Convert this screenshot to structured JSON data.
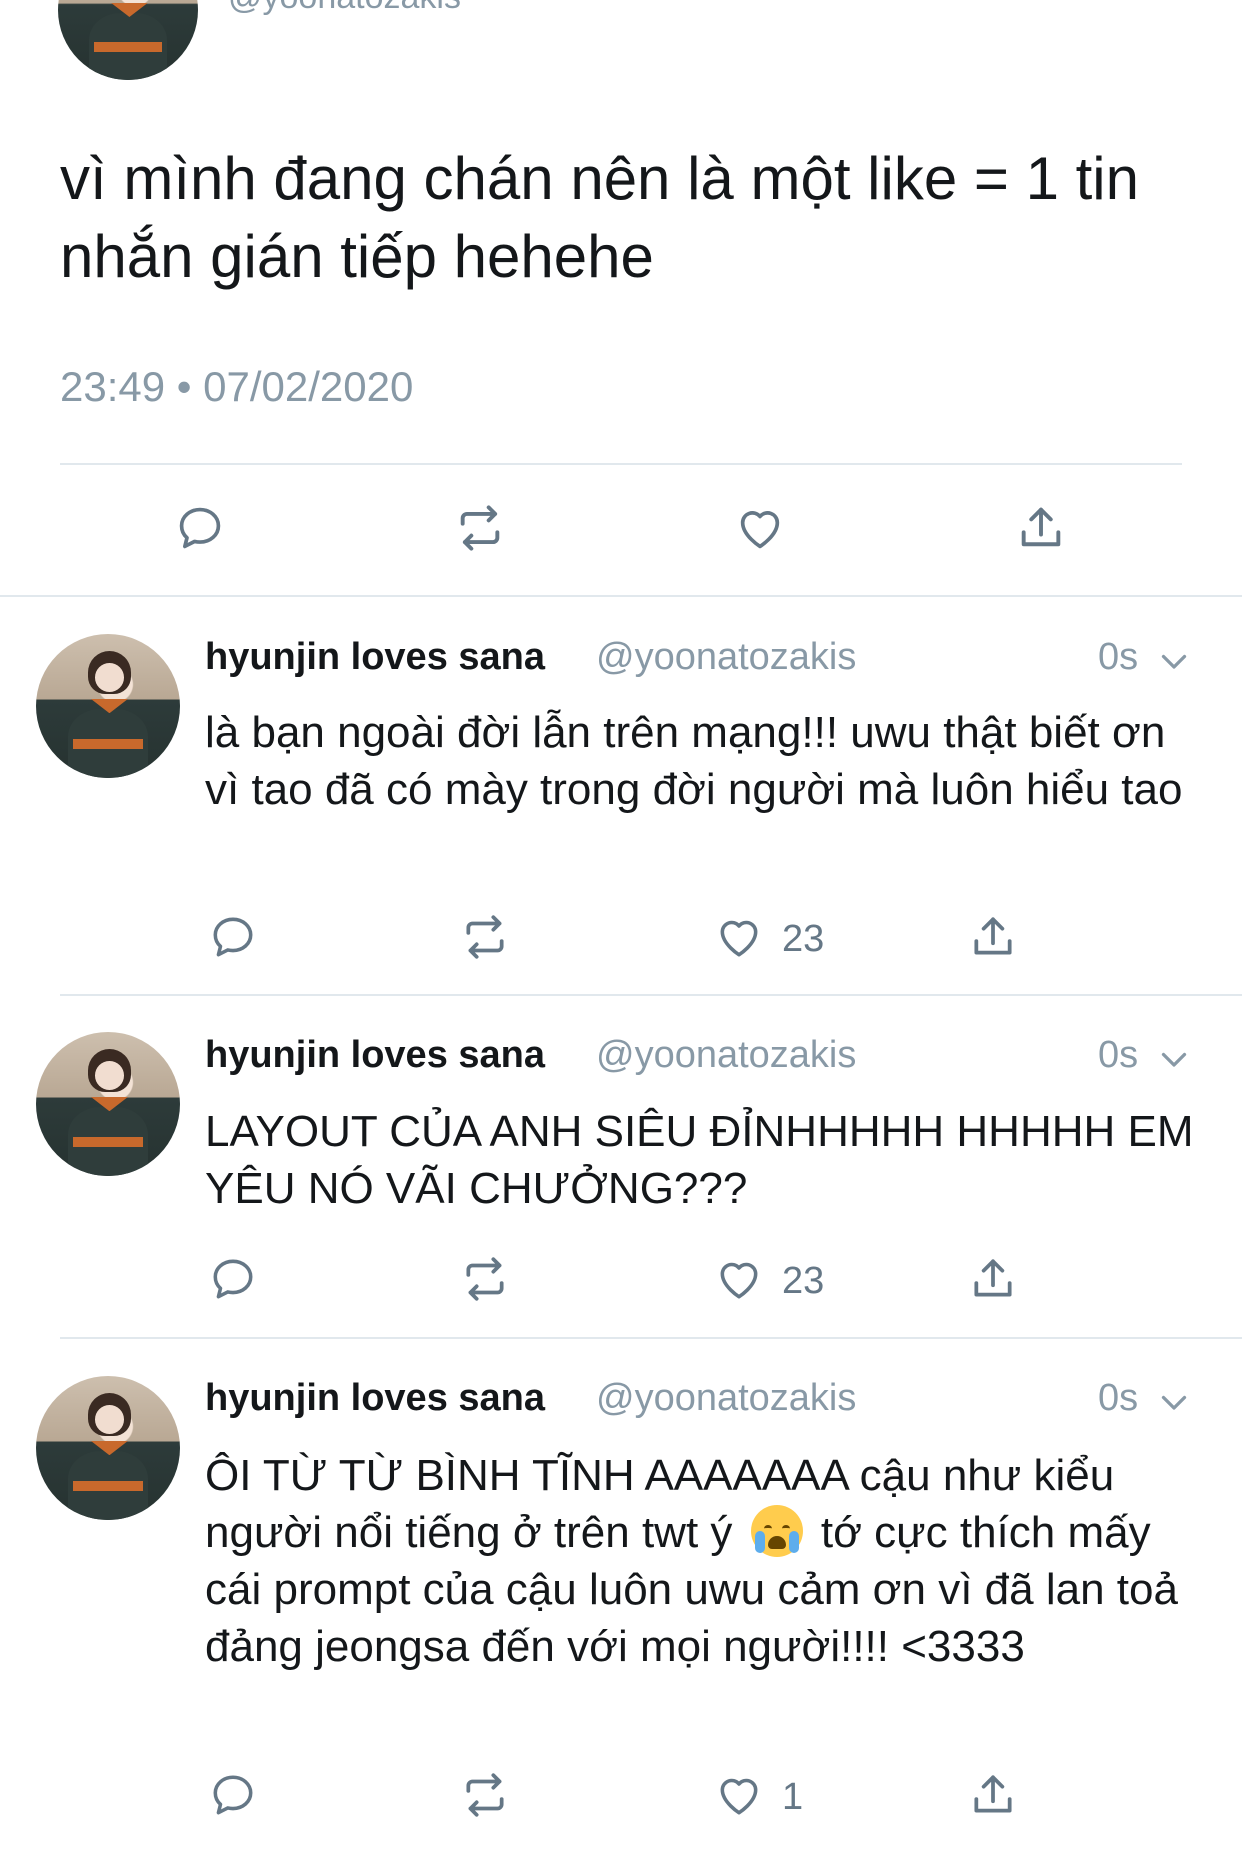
{
  "main_tweet": {
    "handle": "@yoonatozakis",
    "text": "vì mình đang chán nên là một like = 1 tin nhắn gián tiếp hehehe",
    "timestamp": "23:49 • 07/02/2020"
  },
  "replies": [
    {
      "name": "hyunjin loves sana",
      "handle": "@yoonatozakis",
      "time": "0s",
      "text": "là bạn ngoài đời lẫn trên mạng!!! uwu thật biết ơn vì tao đã có mày trong đời người mà luôn hiểu tao",
      "likes": "23"
    },
    {
      "name": "hyunjin loves sana",
      "handle": "@yoonatozakis",
      "time": "0s",
      "text": "LAYOUT CỦA ANH SIÊU ĐỈNHHHHH HHHHH EM YÊU NÓ VÃI CHƯỞNG???",
      "likes": "23"
    },
    {
      "name": "hyunjin loves sana",
      "handle": "@yoonatozakis",
      "time": "0s",
      "text_part1": "ÔI TỪ TỪ BÌNH TĨNH AAAAAAA cậu như kiểu người nổi tiếng ở trên twt ý",
      "text_part2": "tớ cực thích mấy cái prompt của cậu luôn uwu cảm ơn vì đã lan toả đảng jeongsa đến với mọi người!!!! <3333",
      "emoji": "loudly-crying-face",
      "likes": "1"
    }
  ],
  "icons": {
    "reply": "reply-icon",
    "retweet": "retweet-icon",
    "like": "heart-icon",
    "share": "share-icon",
    "chevron": "chevron-down-icon"
  },
  "colors": {
    "text": "#14171a",
    "secondary": "#8899a6",
    "action": "#657786",
    "divider": "#e1e8ed"
  }
}
